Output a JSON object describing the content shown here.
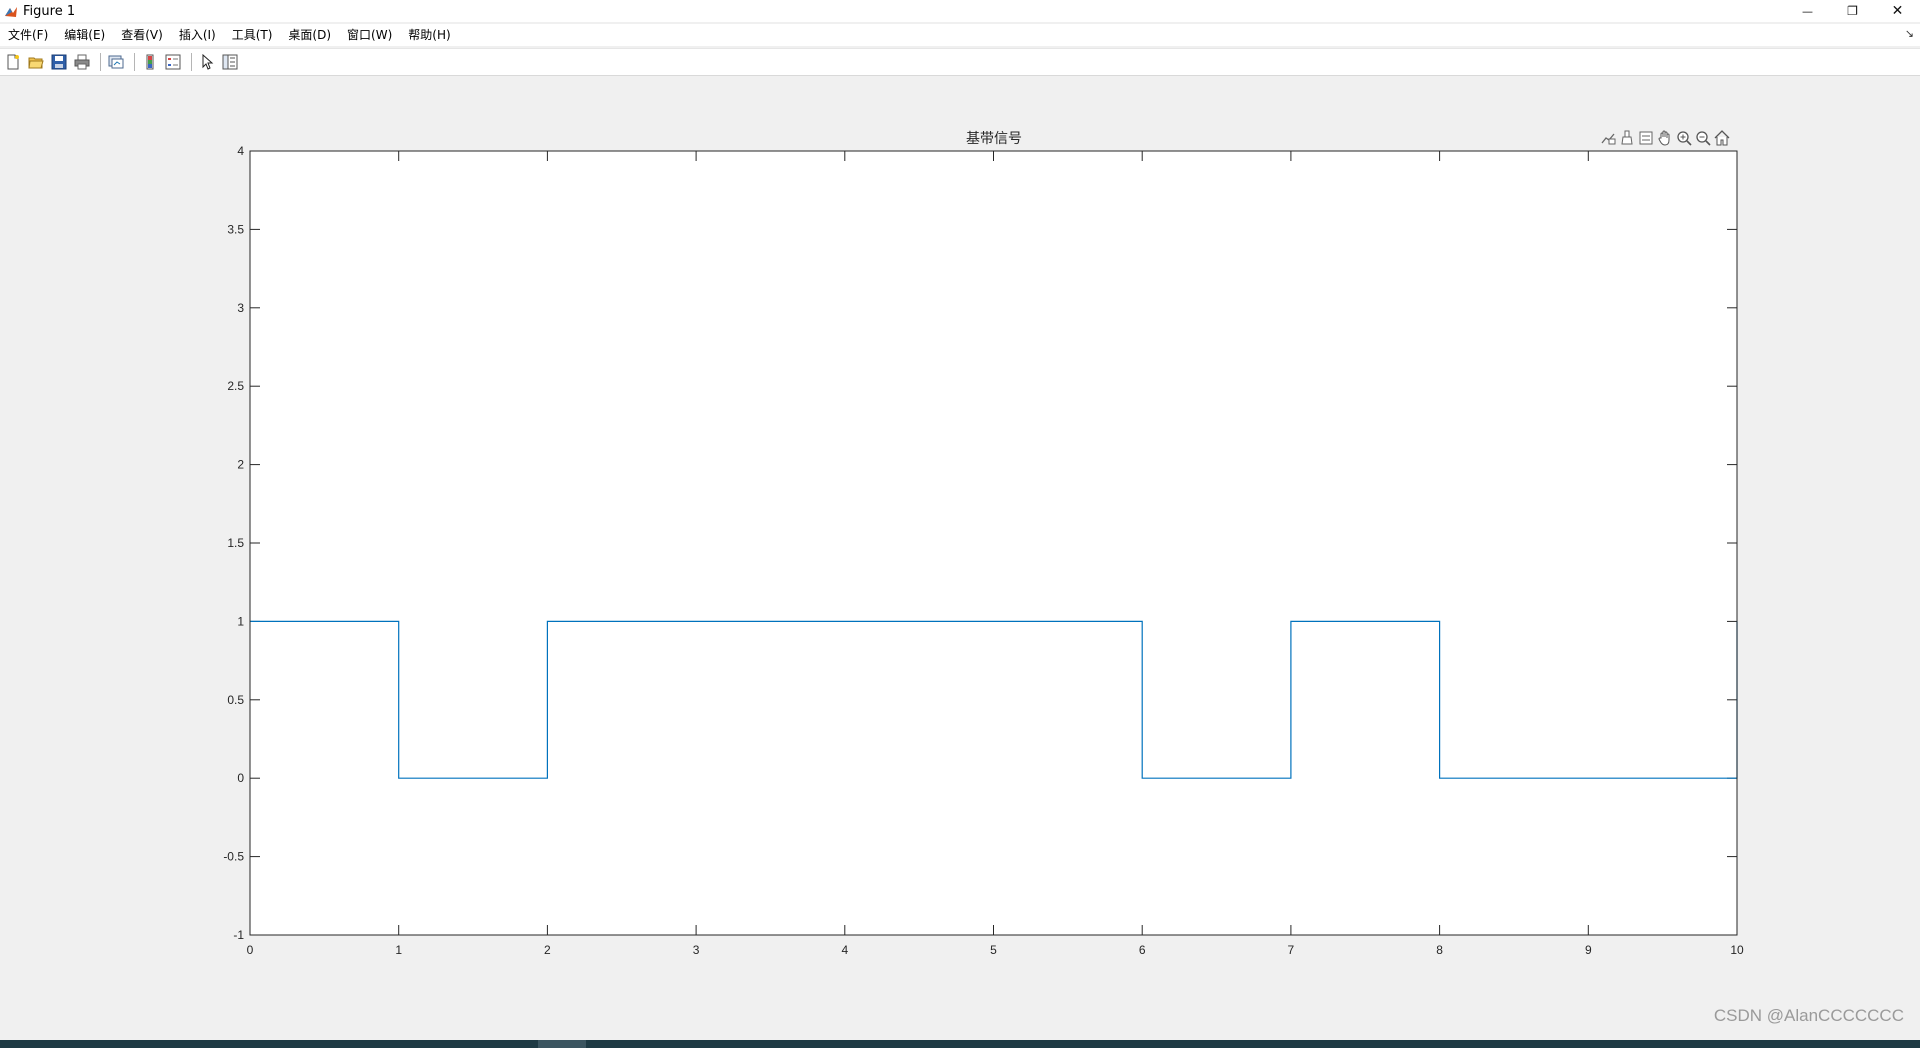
{
  "window": {
    "title": "Figure 1",
    "controls": {
      "minimize": "—",
      "restore": "❐",
      "close": "✕"
    }
  },
  "menu": {
    "items": [
      "文件(F)",
      "编辑(E)",
      "查看(V)",
      "插入(I)",
      "工具(T)",
      "桌面(D)",
      "窗口(W)",
      "帮助(H)"
    ],
    "overflow_glyph": "↘"
  },
  "toolbar": {
    "icons": [
      "new-figure-icon",
      "open-file-icon",
      "save-icon",
      "print-icon",
      "link-plot-icon",
      "colorbar-icon",
      "legend-icon",
      "edit-plot-arrow-icon",
      "property-inspector-icon"
    ]
  },
  "axes_toolbar": {
    "icons": [
      "data-tips-icon",
      "brush-icon",
      "restore-view-icon",
      "pan-hand-icon",
      "zoom-in-icon",
      "zoom-out-icon",
      "home-icon"
    ]
  },
  "chart_data": {
    "type": "line",
    "title": "基带信号",
    "xlabel": "",
    "ylabel": "",
    "xlim": [
      0,
      10
    ],
    "ylim": [
      -1,
      4
    ],
    "xticks": [
      "0",
      "1",
      "2",
      "3",
      "4",
      "5",
      "6",
      "7",
      "8",
      "9",
      "10"
    ],
    "yticks": [
      "-1",
      "-0.5",
      "0",
      "0.5",
      "1",
      "1.5",
      "2",
      "2.5",
      "3",
      "3.5",
      "4"
    ],
    "grid": false,
    "line_color": "#0072bd",
    "series": [
      {
        "x": [
          0,
          1,
          1,
          2,
          2,
          6,
          6,
          7,
          7,
          8,
          8,
          10,
          10
        ],
        "y": [
          1,
          1,
          0,
          0,
          1,
          1,
          0,
          0,
          1,
          1,
          0,
          0,
          1
        ]
      }
    ]
  },
  "watermark": "CSDN @AlanCCCCCCC"
}
